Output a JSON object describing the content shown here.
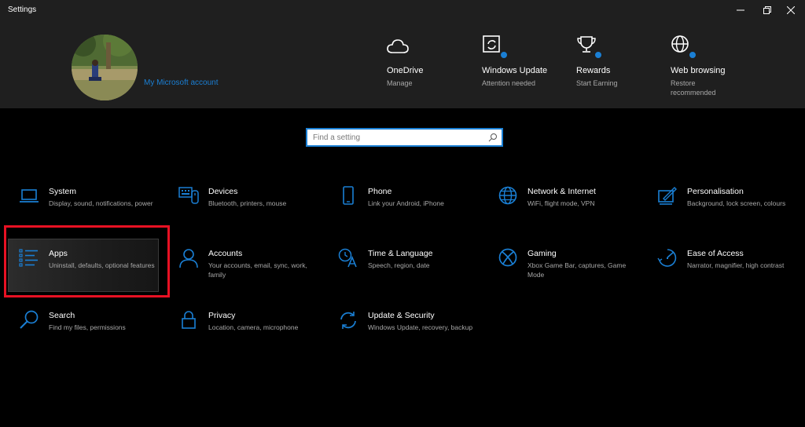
{
  "window": {
    "title": "Settings"
  },
  "account": {
    "link_label": "My Microsoft account"
  },
  "header_items": [
    {
      "title": "OneDrive",
      "sub": "Manage",
      "icon": "cloud-icon"
    },
    {
      "title": "Windows Update",
      "sub": "Attention needed",
      "icon": "update-icon"
    },
    {
      "title": "Rewards",
      "sub": "Start Earning",
      "icon": "trophy-icon"
    },
    {
      "title": "Web browsing",
      "sub": "Restore recommended",
      "icon": "globe-icon"
    }
  ],
  "search": {
    "placeholder": "Find a setting"
  },
  "tiles": [
    {
      "title": "System",
      "sub": "Display, sound, notifications, power",
      "icon": "laptop-icon"
    },
    {
      "title": "Devices",
      "sub": "Bluetooth, printers, mouse",
      "icon": "keyboard-icon"
    },
    {
      "title": "Phone",
      "sub": "Link your Android, iPhone",
      "icon": "phone-icon"
    },
    {
      "title": "Network & Internet",
      "sub": "WiFi, flight mode, VPN",
      "icon": "globe-icon"
    },
    {
      "title": "Personalisation",
      "sub": "Background, lock screen, colours",
      "icon": "paint-icon"
    },
    {
      "title": "Apps",
      "sub": "Uninstall, defaults, optional features",
      "icon": "apps-list-icon"
    },
    {
      "title": "Accounts",
      "sub": "Your accounts, email, sync, work, family",
      "icon": "person-icon"
    },
    {
      "title": "Time & Language",
      "sub": "Speech, region, date",
      "icon": "time-language-icon"
    },
    {
      "title": "Gaming",
      "sub": "Xbox Game Bar, captures, Game Mode",
      "icon": "xbox-icon"
    },
    {
      "title": "Ease of Access",
      "sub": "Narrator, magnifier, high contrast",
      "icon": "ease-of-access-icon"
    },
    {
      "title": "Search",
      "sub": "Find my files, permissions",
      "icon": "search-icon"
    },
    {
      "title": "Privacy",
      "sub": "Location, camera, microphone",
      "icon": "lock-icon"
    },
    {
      "title": "Update & Security",
      "sub": "Windows Update, recovery, backup",
      "icon": "refresh-icon"
    }
  ],
  "colors": {
    "accent": "#1a7fd4",
    "highlight": "#e81123",
    "header_bg": "#1f1f1f"
  }
}
